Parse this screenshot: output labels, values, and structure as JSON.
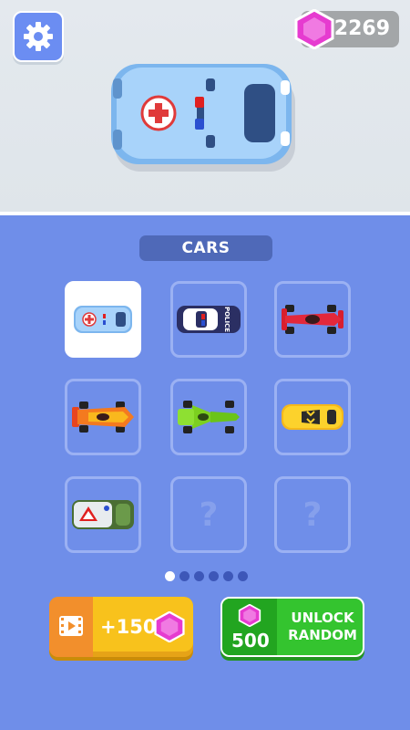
{
  "header": {
    "settings_icon": "gear-icon",
    "gem_icon": "pink-hexagon-gem-icon",
    "gem_count": "2269"
  },
  "preview": {
    "car": "ambulance"
  },
  "category": {
    "label": "CARS"
  },
  "grid": {
    "items": [
      {
        "name": "ambulance",
        "selected": true
      },
      {
        "name": "police-car"
      },
      {
        "name": "red-f1-car"
      },
      {
        "name": "orange-race-car"
      },
      {
        "name": "green-race-car"
      },
      {
        "name": "yellow-sports-car"
      },
      {
        "name": "rescue-truck"
      },
      {
        "name": "locked",
        "text": "?"
      },
      {
        "name": "locked",
        "text": "?"
      }
    ]
  },
  "pagination": {
    "pages": 6,
    "active": 1
  },
  "buttons": {
    "video": {
      "icon": "video-icon",
      "amount": "+150",
      "gem_icon": "pink-hexagon-gem-icon"
    },
    "unlock": {
      "price": "500",
      "label_line1": "UNLOCK",
      "label_line2": "RANDOM",
      "gem_icon": "pink-hexagon-gem-icon"
    }
  },
  "colors": {
    "panel": "#6f8ee9",
    "gem": "#e63bd0",
    "video_button": "#f8c21c",
    "unlock_button": "#34c42f"
  }
}
